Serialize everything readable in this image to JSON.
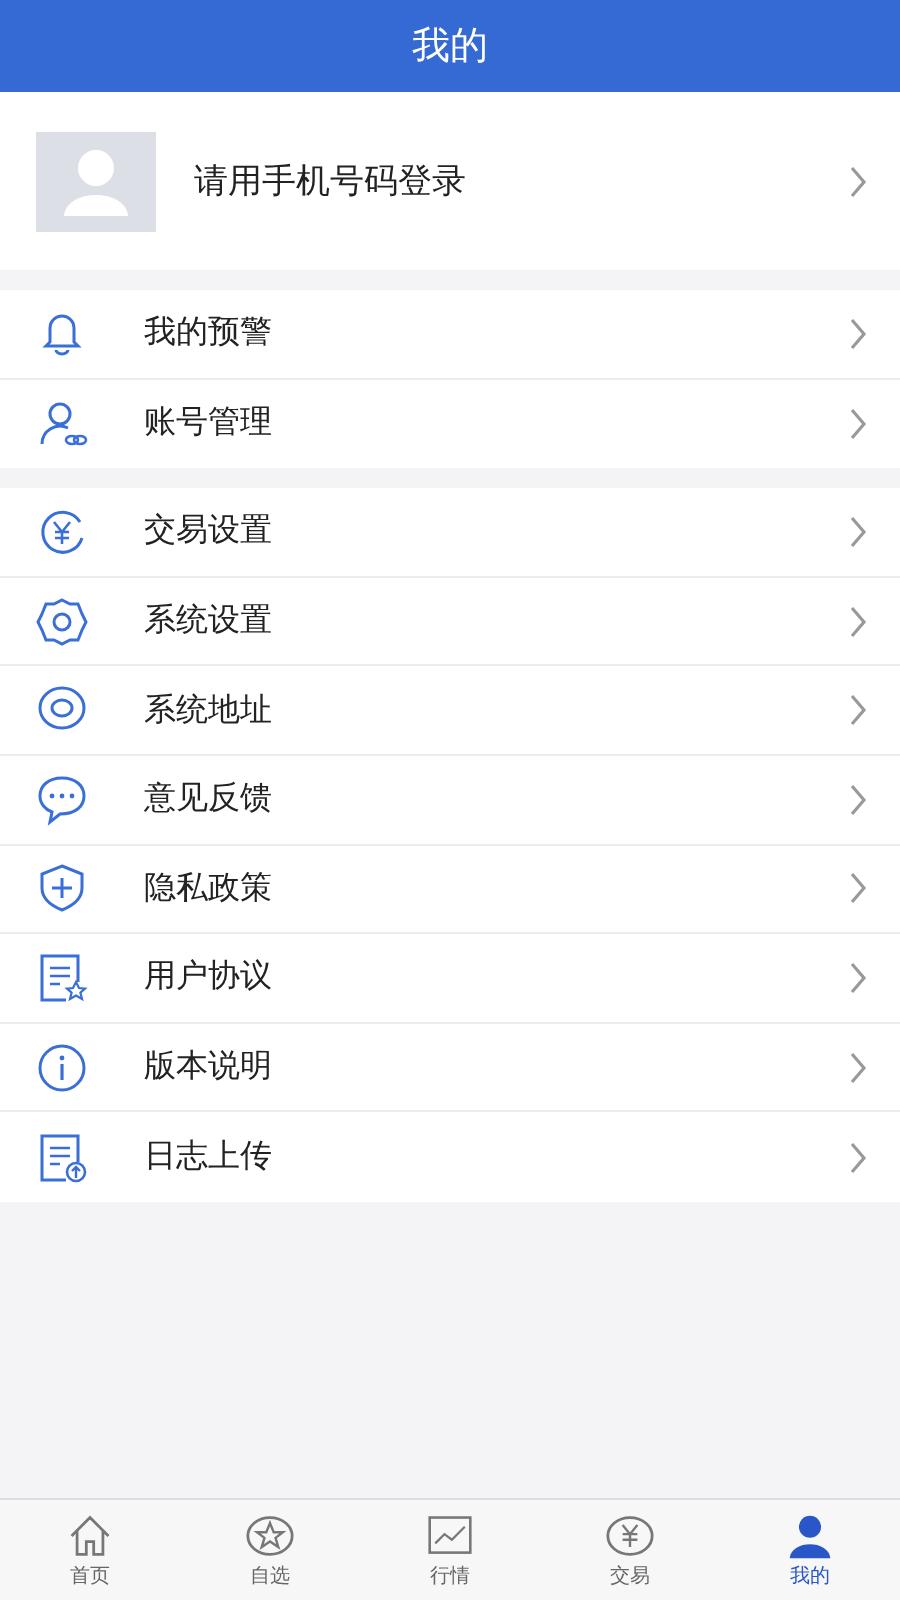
{
  "header": {
    "title": "我的"
  },
  "login": {
    "text": "请用手机号码登录"
  },
  "groups": [
    [
      {
        "label": "我的预警"
      },
      {
        "label": "账号管理"
      }
    ],
    [
      {
        "label": "交易设置"
      },
      {
        "label": "系统设置"
      },
      {
        "label": "系统地址"
      },
      {
        "label": "意见反馈"
      },
      {
        "label": "隐私政策"
      },
      {
        "label": "用户协议"
      },
      {
        "label": "版本说明"
      },
      {
        "label": "日志上传"
      }
    ]
  ],
  "tabs": [
    {
      "label": "首页",
      "selected": false
    },
    {
      "label": "自选",
      "selected": false
    },
    {
      "label": "行情",
      "selected": false
    },
    {
      "label": "交易",
      "selected": false
    },
    {
      "label": "我的",
      "selected": true
    }
  ]
}
